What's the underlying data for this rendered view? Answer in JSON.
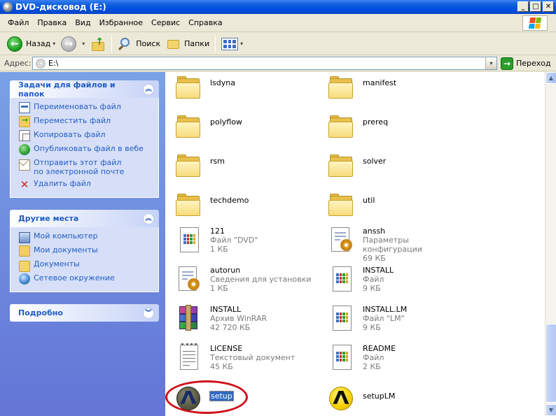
{
  "window": {
    "title": "DVD-дисковод (E:)",
    "minimize": "_",
    "maximize": "□",
    "close": "✕"
  },
  "menu": [
    "Файл",
    "Правка",
    "Вид",
    "Избранное",
    "Сервис",
    "Справка"
  ],
  "toolbar": {
    "back": "Назад",
    "search": "Поиск",
    "folders": "Папки",
    "back_arrow": "←",
    "fwd_arrow": "→",
    "up_arrow": "↑",
    "dropdown": "▾"
  },
  "address": {
    "label": "Адрес:",
    "value": "E:\\",
    "go": "Переход",
    "dropdown": "▾",
    "go_arrow": "→"
  },
  "tasks_panel": {
    "title": "Задачи для файлов и папок",
    "chevron": "︽",
    "items": [
      {
        "label": "Переименовать файл",
        "icon": "rename-icon"
      },
      {
        "label": "Переместить файл",
        "icon": "move-icon"
      },
      {
        "label": "Копировать файл",
        "icon": "copy-icon"
      },
      {
        "label": "Опубликовать файл в вебе",
        "icon": "publish-web-icon"
      },
      {
        "label": "Отправить этот файл по электронной почте",
        "icon": "email-icon"
      },
      {
        "label": "Удалить файл",
        "icon": "delete-icon"
      }
    ]
  },
  "places_panel": {
    "title": "Другие места",
    "chevron": "︽",
    "items": [
      {
        "label": "Мой компьютер",
        "icon": "computer-icon"
      },
      {
        "label": "Мои документы",
        "icon": "documents-icon"
      },
      {
        "label": "Документы",
        "icon": "folder-icon"
      },
      {
        "label": "Сетевое окружение",
        "icon": "network-icon"
      }
    ]
  },
  "details_panel": {
    "title": "Подробно",
    "chevron": "︾"
  },
  "files": [
    {
      "name": "lsdyna",
      "type": "",
      "size": "",
      "icon": "folder"
    },
    {
      "name": "manifest",
      "type": "",
      "size": "",
      "icon": "folder"
    },
    {
      "name": "polyflow",
      "type": "",
      "size": "",
      "icon": "folder"
    },
    {
      "name": "prereq",
      "type": "",
      "size": "",
      "icon": "folder"
    },
    {
      "name": "rsm",
      "type": "",
      "size": "",
      "icon": "folder"
    },
    {
      "name": "solver",
      "type": "",
      "size": "",
      "icon": "folder"
    },
    {
      "name": "techdemo",
      "type": "",
      "size": "",
      "icon": "folder"
    },
    {
      "name": "util",
      "type": "",
      "size": "",
      "icon": "folder"
    },
    {
      "name": "121",
      "type": "Файл \"DVD\"",
      "size": "1 КБ",
      "icon": "doc"
    },
    {
      "name": "anssh",
      "type": "Параметры конфигурации",
      "size": "69 КБ",
      "icon": "cfg"
    },
    {
      "name": "autorun",
      "type": "Сведения для установки",
      "size": "1 КБ",
      "icon": "cfg"
    },
    {
      "name": "INSTALL",
      "type": "Файл",
      "size": "9 КБ",
      "icon": "doc"
    },
    {
      "name": "INSTALL",
      "type": "Архив WinRAR",
      "size": "42 720 КБ",
      "icon": "rar"
    },
    {
      "name": "INSTALL.LM",
      "type": "Файл \"LM\"",
      "size": "9 КБ",
      "icon": "doc"
    },
    {
      "name": "LICENSE",
      "type": "Текстовый документ",
      "size": "45 КБ",
      "icon": "txt"
    },
    {
      "name": "README",
      "type": "Файл",
      "size": "2 КБ",
      "icon": "doc"
    },
    {
      "name": "setup",
      "type": "",
      "size": "",
      "icon": "ansys-dark",
      "selected": true
    },
    {
      "name": "setupLM",
      "type": "",
      "size": "",
      "icon": "ansys-yellow"
    }
  ],
  "scrollbar": {
    "up": "▲",
    "down": "▼"
  }
}
